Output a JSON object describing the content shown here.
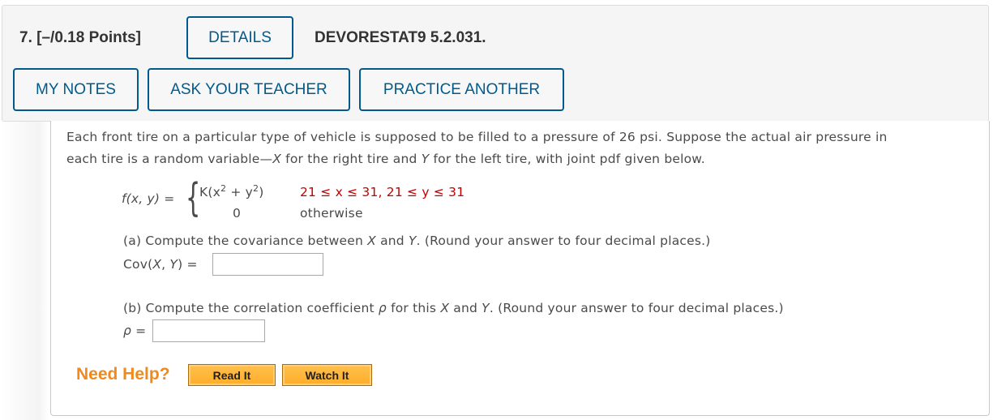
{
  "header": {
    "question_number": "7.",
    "points": "[–/0.18 Points]",
    "details_label": "DETAILS",
    "problem_code": "DEVORESTAT9 5.2.031.",
    "my_notes_label": "MY NOTES",
    "ask_teacher_label": "ASK YOUR TEACHER",
    "practice_another_label": "PRACTICE ANOTHER"
  },
  "problem": {
    "line1": "Each front tire on a particular type of vehicle is supposed to be filled to a pressure of 26 psi. Suppose the actual air pressure in",
    "line2_pre": "each tire is a random variable—",
    "line2_x": "X",
    "line2_mid": " for the right tire and ",
    "line2_y": "Y",
    "line2_post": " for the left tire, with joint pdf given below.",
    "pdf_lhs": "f(x, y) =",
    "pdf_case1_expr_K": "K(x",
    "pdf_case1_expr_mid": " + y",
    "pdf_case1_expr_end": ")",
    "pdf_exp": "2",
    "pdf_case1_cond": "21 ≤ x ≤ 31, 21 ≤ y ≤ 31",
    "pdf_case2_expr": "0",
    "pdf_case2_cond": "otherwise",
    "brace": "{"
  },
  "part_a": {
    "prompt_pre": "(a) Compute the covariance between ",
    "prompt_x": "X",
    "prompt_mid": " and ",
    "prompt_y": "Y",
    "prompt_post": ". (Round your answer to four decimal places.)",
    "label_pre": "Cov(",
    "label_x": "X",
    "label_sep": ", ",
    "label_y": "Y",
    "label_post": ")  =",
    "value": ""
  },
  "part_b": {
    "prompt_pre": "(b) Compute the correlation coefficient ",
    "prompt_rho": "ρ",
    "prompt_mid": " for this ",
    "prompt_x": "X",
    "prompt_and": " and ",
    "prompt_y": "Y",
    "prompt_post": ". (Round your answer to four decimal places.)",
    "label_rho": "ρ",
    "label_eq": " =",
    "value": ""
  },
  "help": {
    "label": "Need Help?",
    "read_it": "Read It",
    "watch_it": "Watch It"
  }
}
